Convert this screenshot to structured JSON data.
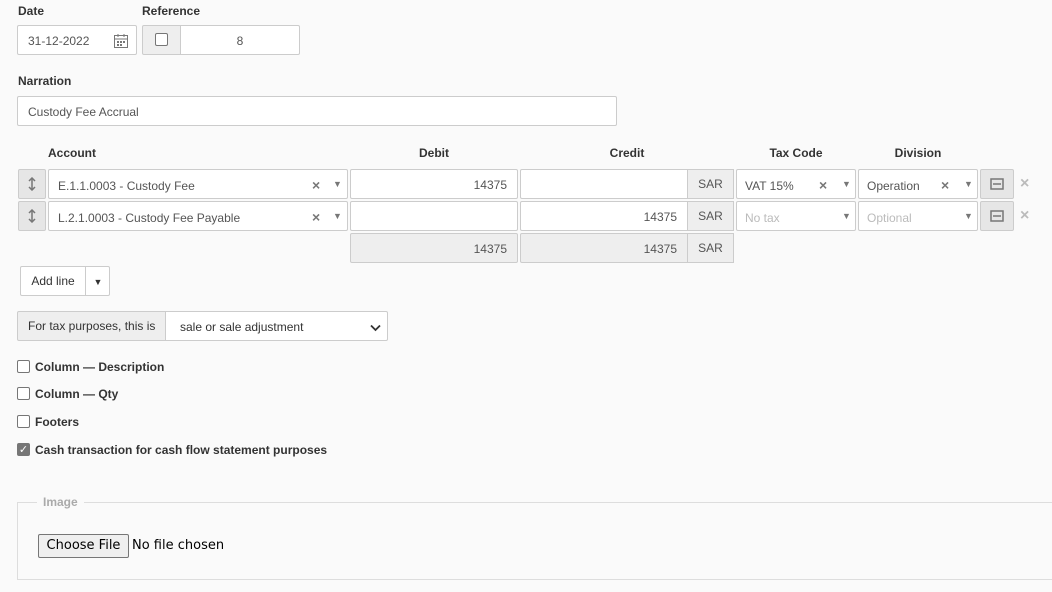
{
  "date": {
    "label": "Date",
    "value": "31-12-2022"
  },
  "reference": {
    "label": "Reference",
    "value": "8"
  },
  "narration": {
    "label": "Narration",
    "value": "Custody Fee Accrual"
  },
  "lines": {
    "headers": {
      "account": "Account",
      "debit": "Debit",
      "credit": "Credit",
      "tax_code": "Tax Code",
      "division": "Division"
    },
    "rows": [
      {
        "account": "E.1.1.0003 - Custody Fee",
        "debit": "14375",
        "credit": "",
        "currency": "SAR",
        "tax_code": "VAT 15%",
        "division": "Operation"
      },
      {
        "account": "L.2.1.0003 - Custody Fee Payable",
        "debit": "",
        "credit": "14375",
        "currency": "SAR",
        "tax_code": "No tax",
        "division": "Optional"
      }
    ],
    "totals": {
      "debit": "14375",
      "credit": "14375",
      "currency": "SAR"
    }
  },
  "add_line_label": "Add line",
  "tax_purpose": {
    "label": "For tax purposes, this is",
    "value": "sale or sale adjustment"
  },
  "checkboxes": [
    {
      "label": "Column — Description",
      "checked": false
    },
    {
      "label": "Column — Qty",
      "checked": false
    },
    {
      "label": "Footers",
      "checked": false
    },
    {
      "label": "Cash transaction for cash flow statement purposes",
      "checked": true
    }
  ],
  "image": {
    "legend": "Image",
    "button": "Choose File",
    "status": "No file chosen"
  }
}
